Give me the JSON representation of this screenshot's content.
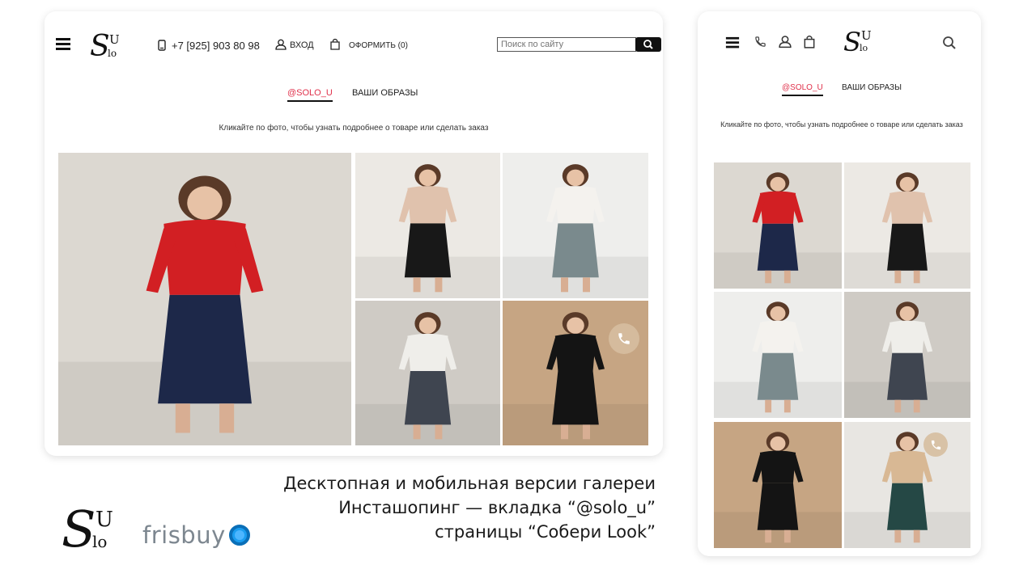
{
  "desktop": {
    "logo": {
      "main": "S",
      "letters": "U",
      "sub": "lo"
    },
    "phone": "+7 [925] 903 80 98",
    "login": "ВХОД",
    "checkout": "ОФОРМИТЬ (0)",
    "search": {
      "placeholder": "Поиск по сайту"
    },
    "tabs": [
      {
        "label": "@SOLO_U",
        "active": true
      },
      {
        "label": "ВАШИ ОБРАЗЫ",
        "active": false
      }
    ],
    "hint": "Кликайте по фото, чтобы узнать подробнее о товаре или сделать заказ",
    "photos": [
      {
        "name": "red-sweater-navy-skirt",
        "top": "#d21f23",
        "bottom": "#1d2849",
        "bg": "#dcd8d1"
      },
      {
        "name": "beige-top-quilted-skirt",
        "top": "#e0c2ad",
        "bottom": "#181818",
        "bg": "#ece9e4"
      },
      {
        "name": "white-top-grey-skirt",
        "top": "#f4f2ee",
        "bottom": "#7a8a8d",
        "bg": "#eeeeec"
      },
      {
        "name": "white-top-tweed-skirt",
        "top": "#efeeea",
        "bottom": "#3f4550",
        "bg": "#cfcbc5"
      },
      {
        "name": "black-dress",
        "top": "#141414",
        "bottom": "#141414",
        "bg": "#c6a583"
      }
    ]
  },
  "mobile": {
    "tabs": [
      {
        "label": "@SOLO_U",
        "active": true
      },
      {
        "label": "ВАШИ ОБРАЗЫ",
        "active": false
      }
    ],
    "hint": "Кликайте по фото, чтобы узнать подробнее о товаре или сделать заказ",
    "photos": [
      {
        "name": "red-sweater-navy-skirt",
        "top": "#d21f23",
        "bottom": "#1d2849",
        "bg": "#dcd8d1"
      },
      {
        "name": "beige-top-quilted-skirt",
        "top": "#e0c2ad",
        "bottom": "#181818",
        "bg": "#ece9e4"
      },
      {
        "name": "white-top-grey-skirt",
        "top": "#f4f2ee",
        "bottom": "#7a8a8d",
        "bg": "#eeeeec"
      },
      {
        "name": "white-top-tweed-skirt",
        "top": "#efeeea",
        "bottom": "#3f4550",
        "bg": "#cfcbc5"
      },
      {
        "name": "black-dress",
        "top": "#141414",
        "bottom": "#141414",
        "bg": "#c6a583"
      },
      {
        "name": "beige-sweater-green-skirt",
        "top": "#d8b894",
        "bottom": "#254845",
        "bg": "#e8e6e2"
      }
    ]
  },
  "caption": {
    "line1": "Десктопная и мобильная версии галереи",
    "line2": "Инсташопинг — вкладка “@solo_u”",
    "line3": "страницы “Собери Look”"
  },
  "brand": {
    "solo_logo": "SoloU",
    "frisbuy": "frisbuy",
    "frisbuy_color": "#1a9df0"
  },
  "colors": {
    "accent": "#e0314b",
    "text": "#222222",
    "call_button": "#d6bea0"
  }
}
